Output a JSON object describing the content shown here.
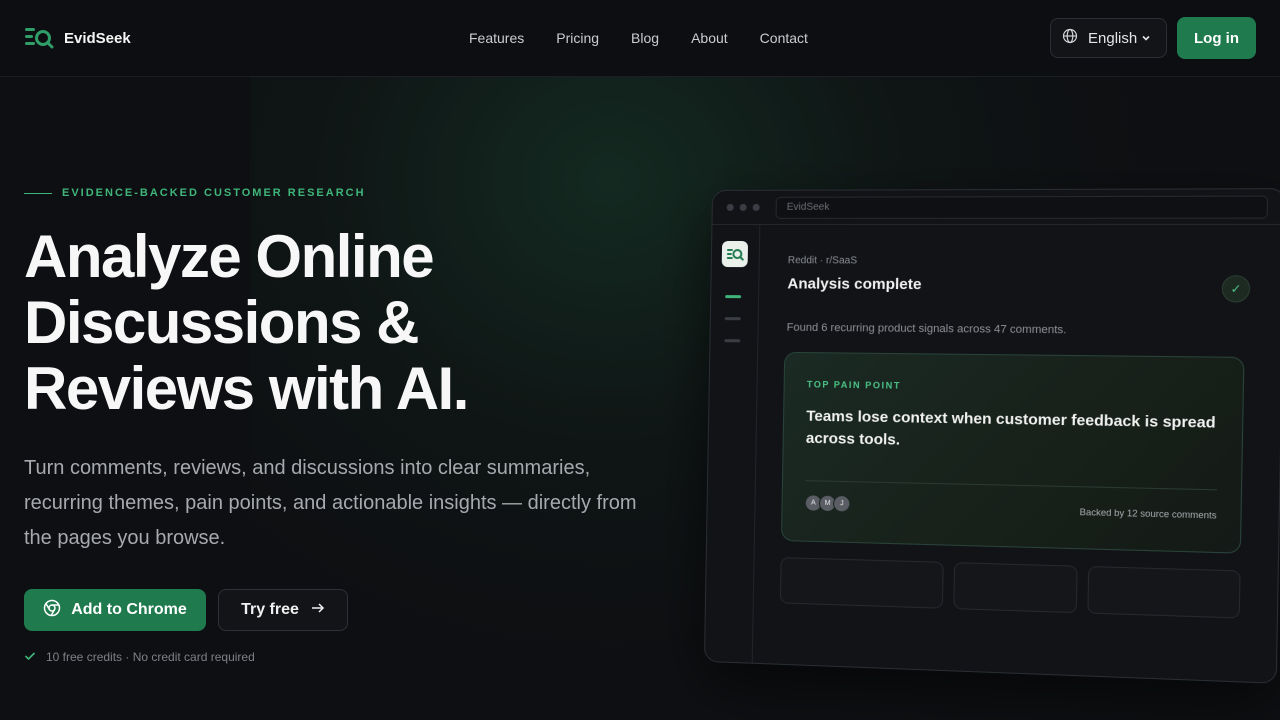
{
  "brand": {
    "name": "EvidSeek"
  },
  "nav": {
    "items": [
      "Features",
      "Pricing",
      "Blog",
      "About",
      "Contact"
    ]
  },
  "header": {
    "language": "English",
    "login_label": "Log in"
  },
  "hero": {
    "eyebrow": "EVIDENCE-BACKED CUSTOMER RESEARCH",
    "headline": "Analyze Online Discussions & Reviews with AI.",
    "subtitle": "Turn comments, reviews, and discussions into clear summaries, recurring themes, pain points, and actionable insights — directly from the pages you browse.",
    "primary_cta": "Add to Chrome",
    "secondary_cta": "Try free",
    "note": "10 free credits · No credit card required"
  },
  "mock": {
    "url_text": "EvidSeek",
    "source": "Reddit · r/SaaS",
    "status": "Analysis complete",
    "summary": "Found 6 recurring product signals across 47 comments.",
    "card": {
      "label": "TOP PAIN POINT",
      "text": "Teams lose context when customer feedback is spread across tools.",
      "avatars": [
        "A",
        "M",
        "J"
      ],
      "backed": "Backed by 12 source comments"
    }
  },
  "colors": {
    "accent": "#1f7a4d",
    "accent_text": "#3fb57a",
    "background": "#0e0f12"
  },
  "icons": {
    "logo": "magnifier-list-icon",
    "language": "globe-icon",
    "chevron": "chevron-down-icon",
    "chrome": "chrome-icon",
    "arrow": "arrow-right-icon",
    "check": "check-icon"
  }
}
